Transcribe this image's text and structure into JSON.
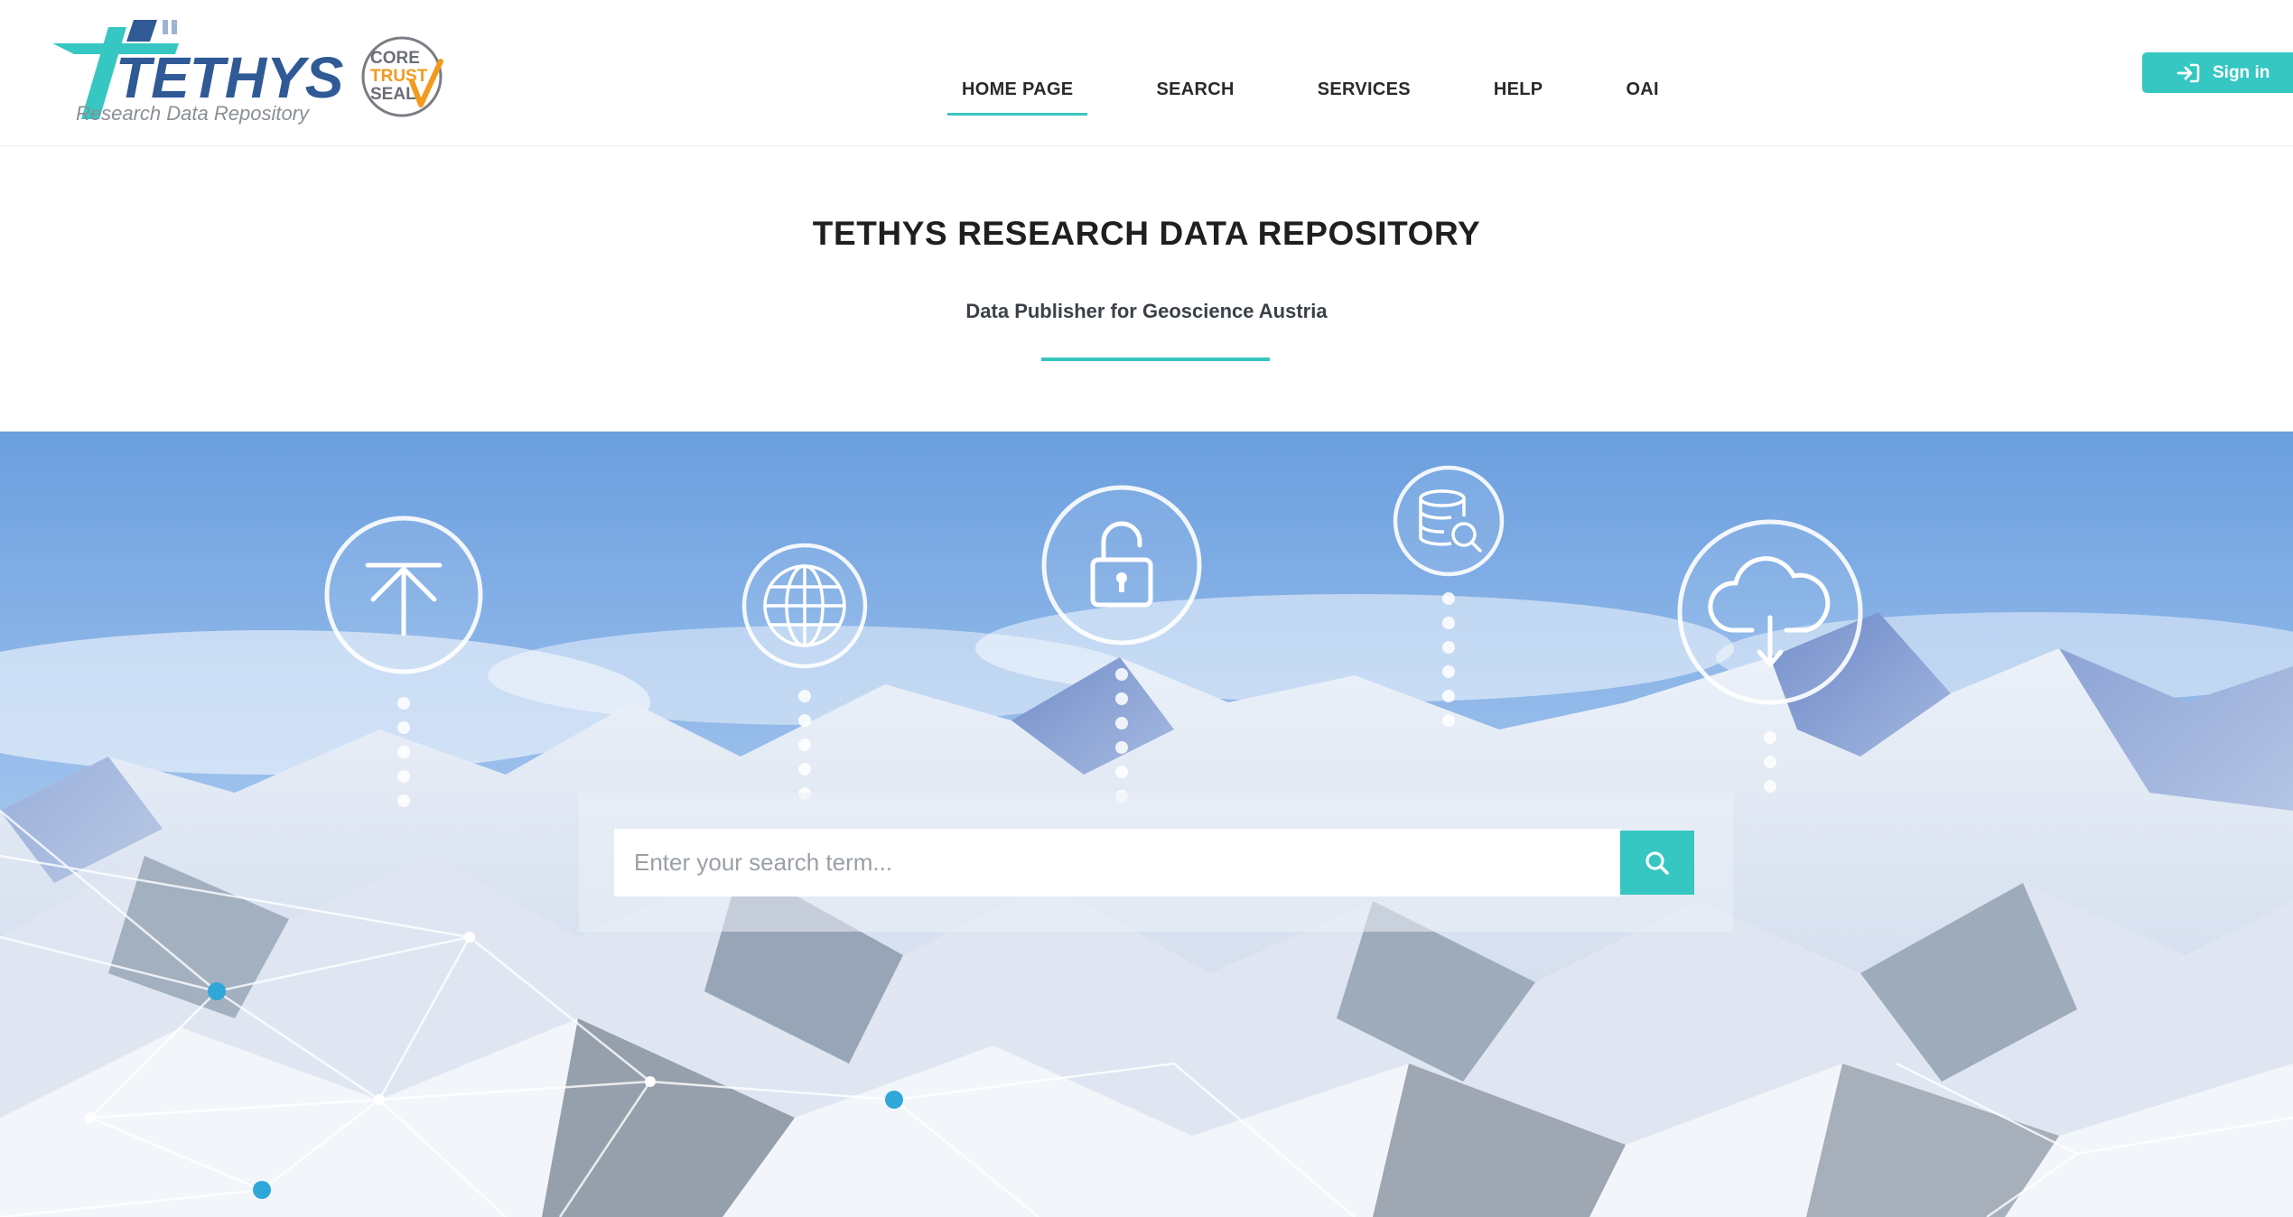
{
  "brand": {
    "logo_text": "TETHYS",
    "logo_tagline": "Research Data Repository",
    "seal_line1": "CORE",
    "seal_line2": "TRUST",
    "seal_line3": "SEAL",
    "colors": {
      "teal": "#36c7c2",
      "navy": "#2f5a96",
      "orange": "#f39a1e"
    }
  },
  "nav": {
    "items": [
      {
        "label": "HOME PAGE",
        "active": true
      },
      {
        "label": "SEARCH",
        "active": false
      },
      {
        "label": "SERVICES",
        "active": false
      },
      {
        "label": "HELP",
        "active": false
      },
      {
        "label": "OAI",
        "active": false
      }
    ]
  },
  "signin": {
    "label": "Sign in",
    "icon": "sign-in-icon"
  },
  "intro": {
    "title": "TETHYS RESEARCH DATA REPOSITORY",
    "subtitle": "Data Publisher for Geoscience Austria"
  },
  "hero": {
    "icons": [
      "upload-icon",
      "globe-icon",
      "lock-icon",
      "database-search-icon",
      "cloud-download-icon"
    ]
  },
  "search": {
    "placeholder": "Enter your search term...",
    "value": "",
    "button_icon": "search-icon"
  }
}
